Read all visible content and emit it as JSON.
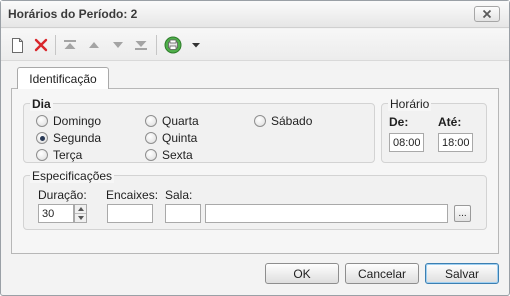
{
  "window": {
    "title": "Horários do Período: 2"
  },
  "toolbar": {
    "buttons": [
      {
        "name": "new-document-icon"
      },
      {
        "name": "delete-x-icon"
      },
      {
        "name": "move-first-icon"
      },
      {
        "name": "move-up-icon"
      },
      {
        "name": "move-down-icon"
      },
      {
        "name": "move-last-icon"
      },
      {
        "name": "print-icon"
      },
      {
        "name": "dropdown-arrow-icon"
      }
    ]
  },
  "tabs": [
    {
      "label": "Identificação",
      "active": true
    }
  ],
  "dia": {
    "legend": "Dia",
    "options": [
      {
        "label": "Domingo",
        "checked": false
      },
      {
        "label": "Segunda",
        "checked": true
      },
      {
        "label": "Terça",
        "checked": false
      },
      {
        "label": "Quarta",
        "checked": false
      },
      {
        "label": "Quinta",
        "checked": false
      },
      {
        "label": "Sexta",
        "checked": false
      },
      {
        "label": "Sábado",
        "checked": false
      }
    ]
  },
  "horario": {
    "legend": "Horário",
    "de_label": "De:",
    "de_value": "08:00",
    "ate_label": "Até:",
    "ate_value": "18:00"
  },
  "especificacoes": {
    "legend": "Especificações",
    "duracao_label": "Duração:",
    "duracao_value": "30",
    "encaixes_label": "Encaixes:",
    "encaixes_value": "",
    "sala_label": "Sala:",
    "sala_code": "",
    "sala_name": "",
    "browse_label": "..."
  },
  "buttons": {
    "ok": "OK",
    "cancel": "Cancelar",
    "save": "Salvar"
  },
  "colors": {
    "delete_red": "#d9262b",
    "default_button_border": "#3c7fb1"
  }
}
